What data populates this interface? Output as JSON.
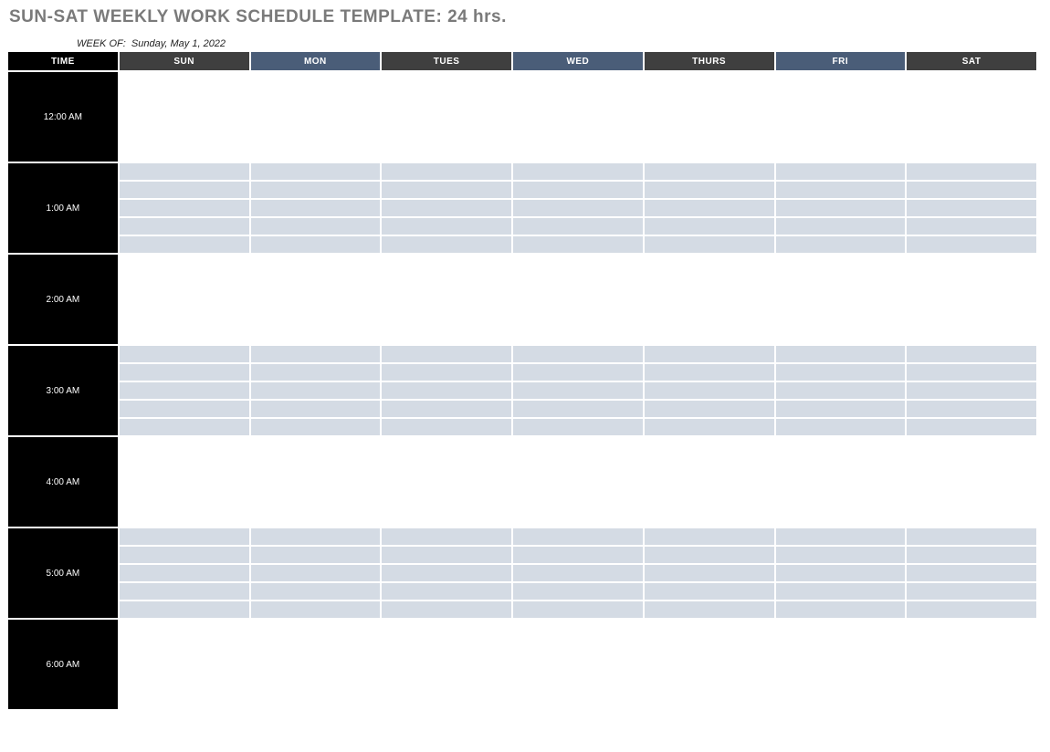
{
  "title": "SUN-SAT WEEKLY WORK SCHEDULE TEMPLATE: 24 hrs.",
  "week_of_label": "WEEK OF:",
  "week_of_value": "Sunday, May 1, 2022",
  "headers": {
    "time": "TIME",
    "days": [
      "SUN",
      "MON",
      "TUES",
      "WED",
      "THURS",
      "FRI",
      "SAT"
    ]
  },
  "time_rows": [
    {
      "label": "12:00 AM",
      "shaded": false
    },
    {
      "label": "1:00 AM",
      "shaded": true
    },
    {
      "label": "2:00 AM",
      "shaded": false
    },
    {
      "label": "3:00 AM",
      "shaded": true
    },
    {
      "label": "4:00 AM",
      "shaded": false
    },
    {
      "label": "5:00 AM",
      "shaded": true
    },
    {
      "label": "6:00 AM",
      "shaded": false
    }
  ],
  "sub_rows_per_hour": 5,
  "day_header_alt_pattern": [
    false,
    true,
    false,
    true,
    false,
    true,
    false
  ]
}
